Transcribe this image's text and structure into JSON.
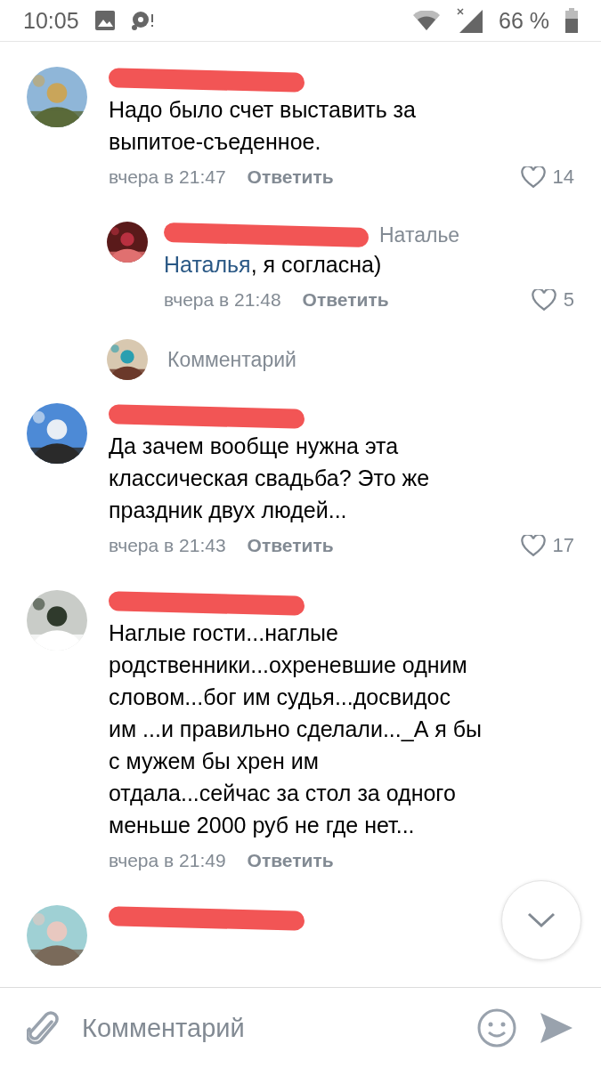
{
  "status_bar": {
    "time": "10:05",
    "battery": "66 %"
  },
  "comments": [
    {
      "kind": "comment",
      "text": "Надо было счет выставить за выпитое-съеденное.",
      "date": "вчера в 21:47",
      "reply": "Ответить",
      "likes": "14"
    },
    {
      "kind": "reply",
      "reply_to": "Наталье",
      "mention": "Наталья",
      "text": ", я согласна)",
      "date": "вчера в 21:48",
      "reply": "Ответить",
      "likes": "5"
    },
    {
      "kind": "composer",
      "placeholder": "Комментарий"
    },
    {
      "kind": "comment",
      "text": "Да зачем вообще нужна эта классическая свадьба? Это же праздник двух людей...",
      "date": "вчера в 21:43",
      "reply": "Ответить",
      "likes": "17"
    },
    {
      "kind": "comment",
      "text": "Наглые гости...наглые родственники...охреневшие одним словом...бог им судья...досвидос им ...и правильно сделали..._А я бы с мужем бы хрен им отдала...сейчас за стол за одного меньше 2000 руб не где нет...",
      "date": "вчера в 21:49",
      "reply": "Ответить"
    },
    {
      "kind": "comment"
    }
  ],
  "input": {
    "placeholder": "Комментарий"
  }
}
